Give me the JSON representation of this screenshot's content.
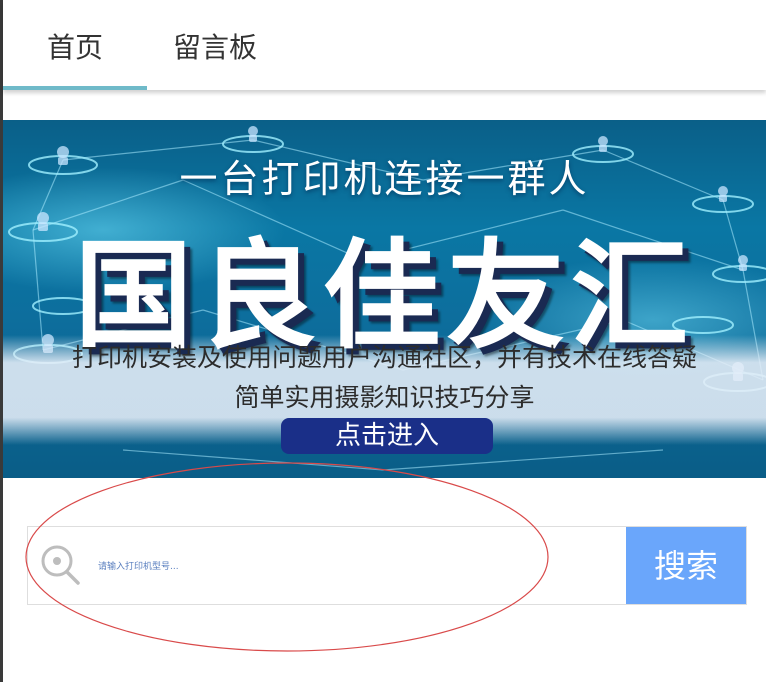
{
  "nav": {
    "tabs": [
      {
        "label": "首页",
        "active": true
      },
      {
        "label": "留言板",
        "active": false
      }
    ],
    "active_color": "#6fbac9"
  },
  "banner": {
    "headline": "一台打印机连接一群人",
    "title": "国良佳友汇",
    "subtitle_1": "打印机安装及使用问题用户沟通社区，并有技术在线答疑",
    "subtitle_2": "简单实用摄影知识技巧分享",
    "enter_button": "点击进入"
  },
  "search": {
    "icon": "search-icon",
    "placeholder": "请输入打印机型号...",
    "button_label": "搜索",
    "button_color": "#6aa6fb"
  },
  "annotation": {
    "shape": "red-ellipse",
    "color": "#d94a4a"
  }
}
